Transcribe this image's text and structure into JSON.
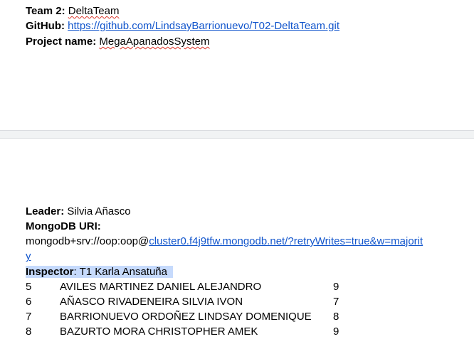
{
  "page1": {
    "team_label": "Team 2:",
    "team_value": "DeltaTeam",
    "github_label": "GitHub:",
    "github_url": "https://github.com/LindsayBarrionuevo/T02-DeltaTeam.git",
    "project_label": "Project name:",
    "project_value": "MegaApanadosSystem"
  },
  "page2": {
    "leader_label": "Leader:",
    "leader_value": "Silvia Añasco",
    "mongo_label": "MongoDB URI:",
    "mongo_prefix": "mongodb+srv://oop:oop@",
    "mongo_link_line1": "cluster0.f4j9tfw.mongodb.net/?retryWrites=true&w=majorit",
    "mongo_link_line2": "y",
    "inspector_label": "Inspector",
    "inspector_value": ": T1 Karla Ansatuña",
    "members": [
      {
        "num": "5",
        "name": "AVILES MARTINEZ DANIEL ALEJANDRO",
        "score": "9"
      },
      {
        "num": "6",
        "name": "AÑASCO RIVADENEIRA SILVIA IVON",
        "score": "7"
      },
      {
        "num": "7",
        "name": "BARRIONUEVO ORDOÑEZ LINDSAY DOMENIQUE",
        "score": "8"
      },
      {
        "num": "8",
        "name": "BAZURTO MORA CHRISTOPHER AMEK",
        "score": "9"
      }
    ]
  },
  "colors": {
    "link": "#1155cc",
    "highlight": "#c6dafc",
    "page_gap": "#f1f3f4",
    "spellcheck": "#d93025"
  }
}
